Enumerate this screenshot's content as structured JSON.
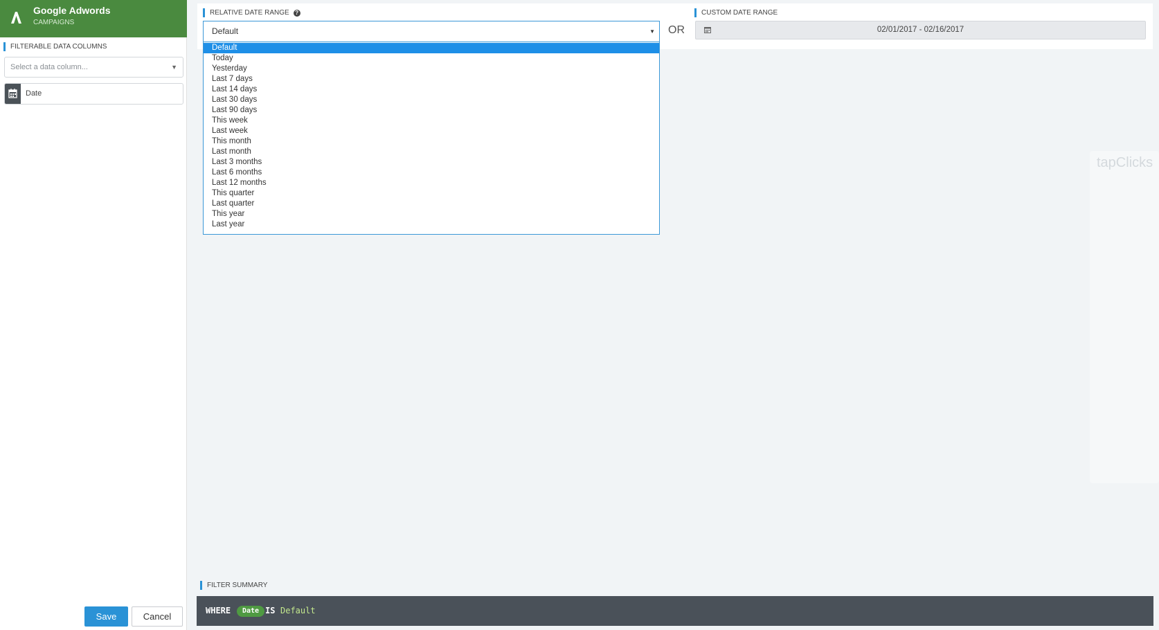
{
  "sidebar": {
    "app_title": "Google Adwords",
    "app_subtitle": "CAMPAIGNS",
    "filterable_label": "FILTERABLE DATA COLUMNS",
    "select_placeholder": "Select a data column...",
    "date_chip_label": "Date",
    "save_label": "Save",
    "cancel_label": "Cancel"
  },
  "relative": {
    "label": "RELATIVE DATE RANGE",
    "selected": "Default",
    "options": [
      "Default",
      "Today",
      "Yesterday",
      "Last 7 days",
      "Last 14 days",
      "Last 30 days",
      "Last 90 days",
      "This week",
      "Last week",
      "This month",
      "Last month",
      "Last 3 months",
      "Last 6 months",
      "Last 12 months",
      "This quarter",
      "Last quarter",
      "This year",
      "Last year"
    ]
  },
  "or_text": "OR",
  "custom": {
    "label": "CUSTOM DATE RANGE",
    "value": "02/01/2017 - 02/16/2017"
  },
  "summary": {
    "label": "FILTER SUMMARY",
    "where": "WHERE",
    "column": "Date",
    "is": "IS",
    "value": "Default"
  },
  "watermark": "tapClicks",
  "colors": {
    "brand_green": "#4a8a3f",
    "accent_blue": "#2a92d6",
    "selected_option": "#1e8fe7",
    "summary_bg": "#4a5159"
  }
}
